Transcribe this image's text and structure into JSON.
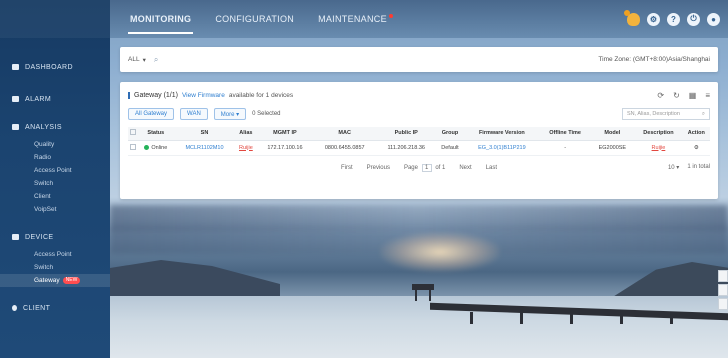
{
  "topbar": {
    "tabs": [
      {
        "label": "MONITORING"
      },
      {
        "label": "CONFIGURATION"
      },
      {
        "label": "MAINTENANCE"
      }
    ],
    "icons": [
      "bell-icon",
      "settings-icon",
      "help-icon",
      "power-icon",
      "user-icon"
    ]
  },
  "sidebar": {
    "sections": [
      {
        "label": "DASHBOARD"
      },
      {
        "label": "ALARM"
      },
      {
        "label": "ANALYSIS",
        "items": [
          "Quality",
          "Radio",
          "Access Point",
          "Switch",
          "Client",
          "VoipSet"
        ]
      },
      {
        "label": "DEVICE",
        "items": [
          "Access Point",
          "Switch",
          "Gateway"
        ],
        "new_badge": "NEW"
      },
      {
        "label": "CLIENT"
      }
    ]
  },
  "search": {
    "selector": "ALL",
    "timezone": "Time Zone: (GMT+8:00)Asia/Shanghai"
  },
  "table_panel": {
    "title": "Gateway (1/1)",
    "link": "View Firmware",
    "link_suffix": "available for 1 devices",
    "buttons": {
      "all_gateway": "All Gateway",
      "wan": "WAN",
      "more": "More ▾"
    },
    "selected_text": "0 Selected",
    "filter_placeholder": "SN, Alias, Description",
    "columns": [
      "Status",
      "SN",
      "Alias",
      "MGMT IP",
      "MAC",
      "Public IP",
      "Group",
      "Firmware Version",
      "Offline Time",
      "Model",
      "Description",
      "Action"
    ],
    "rows": [
      {
        "status": "Online",
        "sn": "MCLR1102M10",
        "alias": "Ruijie",
        "mgmt_ip": "172.17.100.16",
        "mac": "0800.6455.0857",
        "public_ip": "111.206.218.36",
        "group": "Default",
        "firmware": "EG_3.0(1)B11P219",
        "offline_time": "-",
        "model": "EG2000SE",
        "description": "Ruijie",
        "action": "⚙"
      }
    ],
    "pager": {
      "first": "First",
      "previous": "Previous",
      "page_label": "Page",
      "page": "1",
      "of": "of 1",
      "next": "Next",
      "last": "Last",
      "page_size": "10 ▾",
      "total": "1 in total"
    }
  }
}
